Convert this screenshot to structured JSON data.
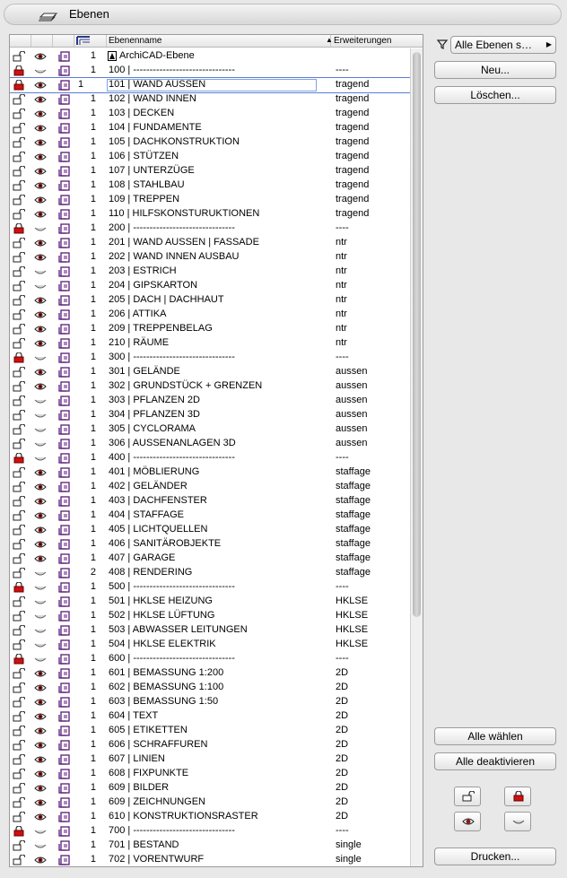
{
  "window": {
    "title": "Ebenen"
  },
  "header": {
    "name_col": "Ebenenname",
    "ext_col": "Erweiterungen"
  },
  "filter": {
    "selected": "Alle Ebenen s…"
  },
  "buttons": {
    "new": "Neu...",
    "delete": "Löschen...",
    "select_all": "Alle wählen",
    "deactivate_all": "Alle deaktivieren",
    "print": "Drucken..."
  },
  "rows": [
    {
      "lock": "open",
      "eye": "open",
      "num": "1",
      "name": "ArchiCAD-Ebene",
      "ext": "",
      "archicad": true
    },
    {
      "lock": "locked",
      "eye": "closed",
      "num": "1",
      "name": "100 | -------------------------------",
      "ext": "----"
    },
    {
      "lock": "locked",
      "eye": "open",
      "num": "1",
      "name": "101 | WAND AUSSEN",
      "ext": "tragend",
      "selected": true
    },
    {
      "lock": "open",
      "eye": "open",
      "num": "1",
      "name": "102 | WAND INNEN",
      "ext": "tragend"
    },
    {
      "lock": "open",
      "eye": "open",
      "num": "1",
      "name": "103 | DECKEN",
      "ext": "tragend"
    },
    {
      "lock": "open",
      "eye": "open",
      "num": "1",
      "name": "104 | FUNDAMENTE",
      "ext": "tragend"
    },
    {
      "lock": "open",
      "eye": "open",
      "num": "1",
      "name": "105 | DACHKONSTRUKTION",
      "ext": "tragend"
    },
    {
      "lock": "open",
      "eye": "open",
      "num": "1",
      "name": "106 | STÜTZEN",
      "ext": "tragend"
    },
    {
      "lock": "open",
      "eye": "open",
      "num": "1",
      "name": "107 | UNTERZÜGE",
      "ext": "tragend"
    },
    {
      "lock": "open",
      "eye": "open",
      "num": "1",
      "name": "108 | STAHLBAU",
      "ext": "tragend"
    },
    {
      "lock": "open",
      "eye": "open",
      "num": "1",
      "name": "109 | TREPPEN",
      "ext": "tragend"
    },
    {
      "lock": "open",
      "eye": "open",
      "num": "1",
      "name": "110 | HILFSKONSTURUKTIONEN",
      "ext": "tragend"
    },
    {
      "lock": "locked",
      "eye": "closed",
      "num": "1",
      "name": "200 | -------------------------------",
      "ext": "----"
    },
    {
      "lock": "open",
      "eye": "open",
      "num": "1",
      "name": "201 | WAND AUSSEN | FASSADE",
      "ext": "ntr"
    },
    {
      "lock": "open",
      "eye": "open",
      "num": "1",
      "name": "202 | WAND INNEN AUSBAU",
      "ext": "ntr"
    },
    {
      "lock": "open",
      "eye": "closed",
      "num": "1",
      "name": "203 | ESTRICH",
      "ext": "ntr"
    },
    {
      "lock": "open",
      "eye": "closed",
      "num": "1",
      "name": "204 | GIPSKARTON",
      "ext": "ntr"
    },
    {
      "lock": "open",
      "eye": "open",
      "num": "1",
      "name": "205 | DACH | DACHHAUT",
      "ext": "ntr"
    },
    {
      "lock": "open",
      "eye": "open",
      "num": "1",
      "name": "206 | ATTIKA",
      "ext": "ntr"
    },
    {
      "lock": "open",
      "eye": "open",
      "num": "1",
      "name": "209 | TREPPENBELAG",
      "ext": "ntr"
    },
    {
      "lock": "open",
      "eye": "open",
      "num": "1",
      "name": "210 | RÄUME",
      "ext": "ntr"
    },
    {
      "lock": "locked",
      "eye": "closed",
      "num": "1",
      "name": "300 | -------------------------------",
      "ext": "----"
    },
    {
      "lock": "open",
      "eye": "open",
      "num": "1",
      "name": "301 | GELÄNDE",
      "ext": "aussen"
    },
    {
      "lock": "open",
      "eye": "open",
      "num": "1",
      "name": "302 | GRUNDSTÜCK + GRENZEN",
      "ext": "aussen"
    },
    {
      "lock": "open",
      "eye": "closed",
      "num": "1",
      "name": "303 | PFLANZEN 2D",
      "ext": "aussen"
    },
    {
      "lock": "open",
      "eye": "closed",
      "num": "1",
      "name": "304 | PFLANZEN 3D",
      "ext": "aussen"
    },
    {
      "lock": "open",
      "eye": "closed",
      "num": "1",
      "name": "305 | CYCLORAMA",
      "ext": "aussen"
    },
    {
      "lock": "open",
      "eye": "closed",
      "num": "1",
      "name": "306 | AUSSENANLAGEN 3D",
      "ext": "aussen"
    },
    {
      "lock": "locked",
      "eye": "closed",
      "num": "1",
      "name": "400 | -------------------------------",
      "ext": "----"
    },
    {
      "lock": "open",
      "eye": "open",
      "num": "1",
      "name": "401 | MÖBLIERUNG",
      "ext": "staffage"
    },
    {
      "lock": "open",
      "eye": "open",
      "num": "1",
      "name": "402 | GELÄNDER",
      "ext": "staffage"
    },
    {
      "lock": "open",
      "eye": "open",
      "num": "1",
      "name": "403 | DACHFENSTER",
      "ext": "staffage"
    },
    {
      "lock": "open",
      "eye": "open",
      "num": "1",
      "name": "404 | STAFFAGE",
      "ext": "staffage"
    },
    {
      "lock": "open",
      "eye": "open",
      "num": "1",
      "name": "405 | LICHTQUELLEN",
      "ext": "staffage"
    },
    {
      "lock": "open",
      "eye": "open",
      "num": "1",
      "name": "406 | SANITÄROBJEKTE",
      "ext": "staffage"
    },
    {
      "lock": "open",
      "eye": "open",
      "num": "1",
      "name": "407 | GARAGE",
      "ext": "staffage"
    },
    {
      "lock": "open",
      "eye": "closed",
      "num": "2",
      "name": "408 | RENDERING",
      "ext": "staffage"
    },
    {
      "lock": "locked",
      "eye": "closed",
      "num": "1",
      "name": "500 | -------------------------------",
      "ext": "----"
    },
    {
      "lock": "open",
      "eye": "closed",
      "num": "1",
      "name": "501 | HKLSE HEIZUNG",
      "ext": "HKLSE"
    },
    {
      "lock": "open",
      "eye": "closed",
      "num": "1",
      "name": "502 | HKLSE LÜFTUNG",
      "ext": "HKLSE"
    },
    {
      "lock": "open",
      "eye": "closed",
      "num": "1",
      "name": "503 | ABWASSER LEITUNGEN",
      "ext": "HKLSE"
    },
    {
      "lock": "open",
      "eye": "closed",
      "num": "1",
      "name": "504 | HKLSE ELEKTRIK",
      "ext": "HKLSE"
    },
    {
      "lock": "locked",
      "eye": "closed",
      "num": "1",
      "name": "600 | -------------------------------",
      "ext": "----"
    },
    {
      "lock": "open",
      "eye": "open",
      "num": "1",
      "name": "601 | BEMASSUNG 1:200",
      "ext": "2D"
    },
    {
      "lock": "open",
      "eye": "open",
      "num": "1",
      "name": "602 | BEMASSUNG 1:100",
      "ext": "2D"
    },
    {
      "lock": "open",
      "eye": "open",
      "num": "1",
      "name": "603 | BEMASSUNG 1:50",
      "ext": "2D"
    },
    {
      "lock": "open",
      "eye": "open",
      "num": "1",
      "name": "604 | TEXT",
      "ext": "2D"
    },
    {
      "lock": "open",
      "eye": "open",
      "num": "1",
      "name": "605 | ETIKETTEN",
      "ext": "2D"
    },
    {
      "lock": "open",
      "eye": "open",
      "num": "1",
      "name": "606 | SCHRAFFUREN",
      "ext": "2D"
    },
    {
      "lock": "open",
      "eye": "open",
      "num": "1",
      "name": "607 | LINIEN",
      "ext": "2D"
    },
    {
      "lock": "open",
      "eye": "open",
      "num": "1",
      "name": "608 | FIXPUNKTE",
      "ext": "2D"
    },
    {
      "lock": "open",
      "eye": "open",
      "num": "1",
      "name": "609 | BILDER",
      "ext": "2D"
    },
    {
      "lock": "open",
      "eye": "open",
      "num": "1",
      "name": "609 | ZEICHNUNGEN",
      "ext": "2D"
    },
    {
      "lock": "open",
      "eye": "open",
      "num": "1",
      "name": "610 | KONSTRUKTIONSRASTER",
      "ext": "2D"
    },
    {
      "lock": "locked",
      "eye": "closed",
      "num": "1",
      "name": "700 | -------------------------------",
      "ext": "----"
    },
    {
      "lock": "open",
      "eye": "closed",
      "num": "1",
      "name": "701 | BESTAND",
      "ext": "single"
    },
    {
      "lock": "open",
      "eye": "open",
      "num": "1",
      "name": "702 | VORENTWURF",
      "ext": "single"
    }
  ]
}
